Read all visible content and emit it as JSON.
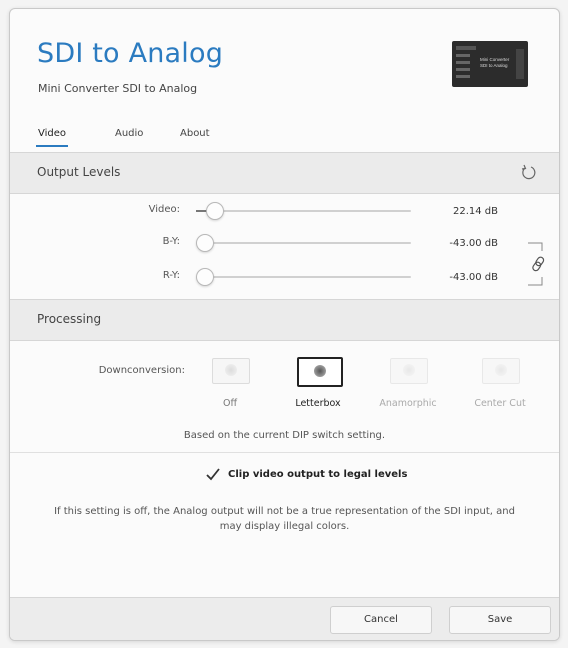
{
  "header": {
    "title": "SDI to Analog",
    "subtitle": "Mini Converter SDI to Analog",
    "device_label_line1": "Mini Converter",
    "device_label_line2": "SDI to Analog"
  },
  "tabs": [
    {
      "label": "Video",
      "active": true
    },
    {
      "label": "Audio",
      "active": false
    },
    {
      "label": "About",
      "active": false
    }
  ],
  "output_levels": {
    "title": "Output Levels",
    "reset_icon": "reset-icon",
    "sliders": [
      {
        "label": "Video:",
        "value": "22.14 dB",
        "level": 0.1
      },
      {
        "label": "B-Y:",
        "value": "-43.00 dB",
        "level": 0.0
      },
      {
        "label": "R-Y:",
        "value": "-43.00 dB",
        "level": 0.0
      }
    ],
    "link_icon": "link-icon"
  },
  "processing": {
    "title": "Processing",
    "downconversion_label": "Downconversion:",
    "options": [
      {
        "label": "Off",
        "state": "normal"
      },
      {
        "label": "Letterbox",
        "state": "selected"
      },
      {
        "label": "Anamorphic",
        "state": "disabled"
      },
      {
        "label": "Center Cut",
        "state": "disabled"
      }
    ],
    "dip_note": "Based on the current DIP switch setting.",
    "clip_label": "Clip video output to legal levels",
    "clip_checked": true,
    "clip_note_line1": "If this setting is off, the Analog output will not be a true representation of the SDI input, and",
    "clip_note_line2": "may display illegal colors."
  },
  "footer": {
    "cancel_label": "Cancel",
    "save_label": "Save"
  },
  "colors": {
    "accent": "#2b7bc0",
    "section_bg": "#ebebeb"
  }
}
